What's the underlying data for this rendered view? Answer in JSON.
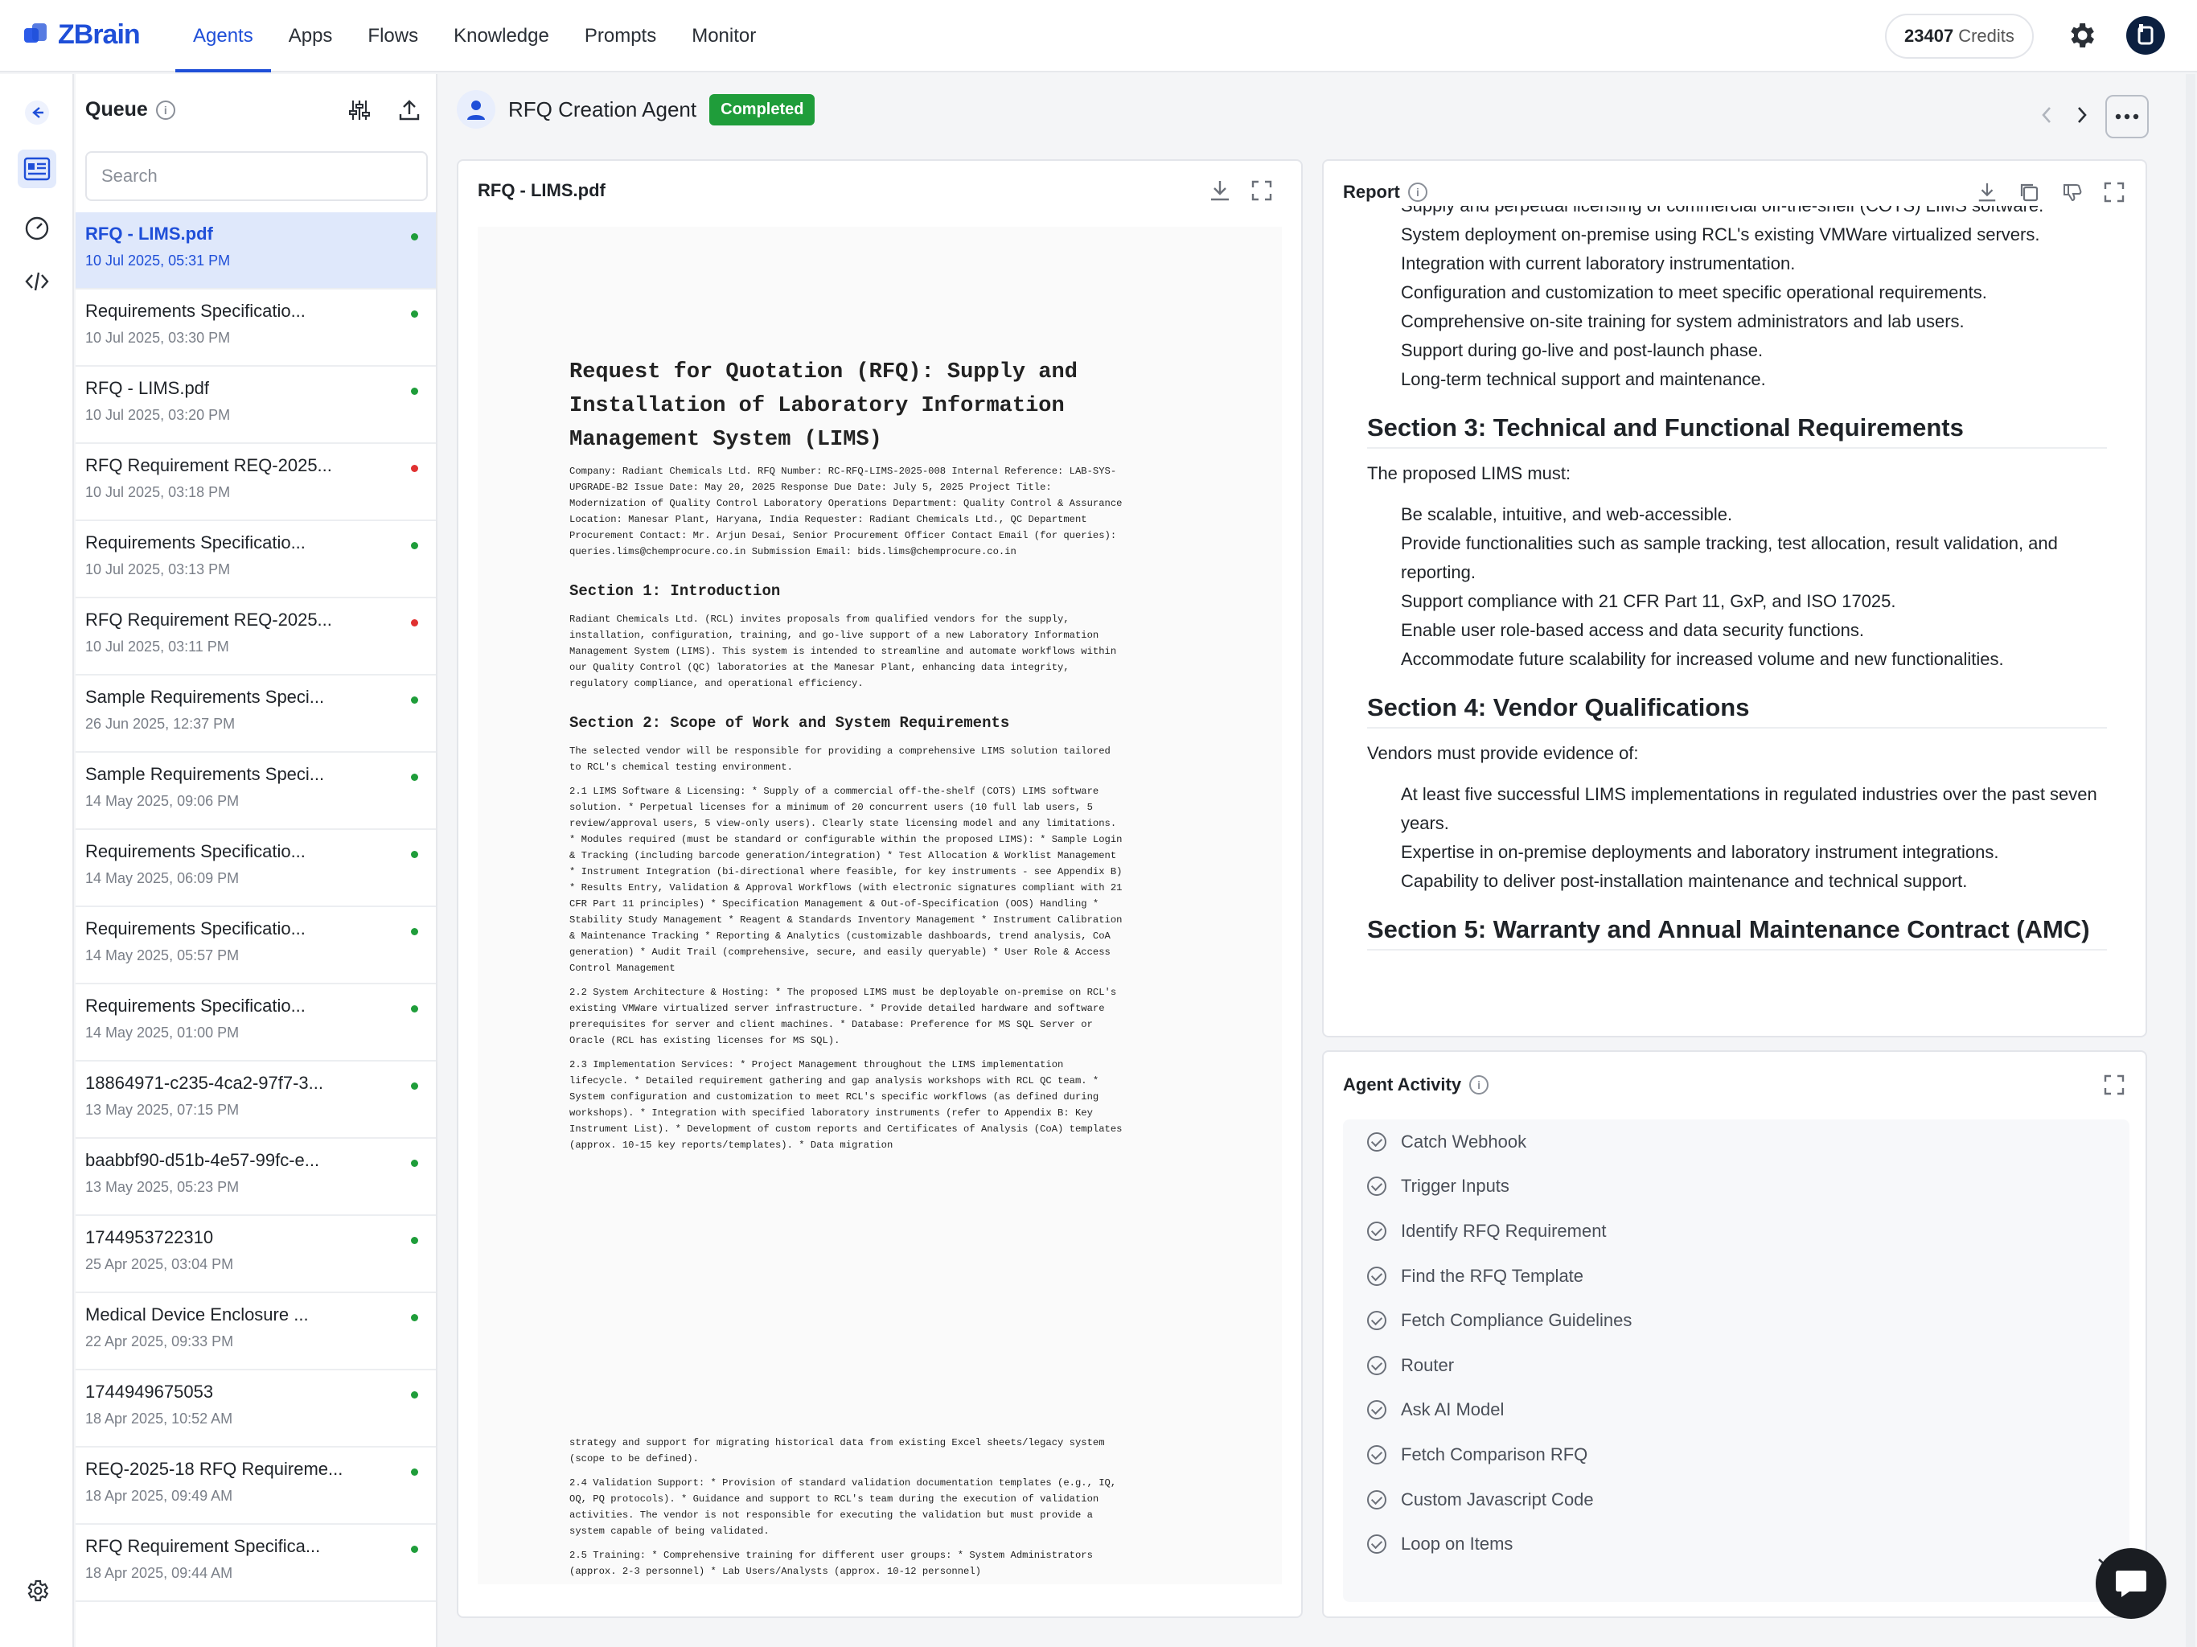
{
  "app": {
    "name": "ZBrain"
  },
  "nav": {
    "items": [
      "Agents",
      "Apps",
      "Flows",
      "Knowledge",
      "Prompts",
      "Monitor"
    ],
    "active": "Agents"
  },
  "credits": {
    "value": "23407",
    "label": "Credits"
  },
  "queue": {
    "title": "Queue",
    "search_placeholder": "Search",
    "items": [
      {
        "title": "RFQ - LIMS.pdf",
        "date": "10 Jul 2025, 05:31 PM",
        "status": "green"
      },
      {
        "title": "Requirements Specificatio...",
        "date": "10 Jul 2025, 03:30 PM",
        "status": "green"
      },
      {
        "title": "RFQ - LIMS.pdf",
        "date": "10 Jul 2025, 03:20 PM",
        "status": "green"
      },
      {
        "title": "RFQ Requirement REQ-2025...",
        "date": "10 Jul 2025, 03:18 PM",
        "status": "red"
      },
      {
        "title": "Requirements Specificatio...",
        "date": "10 Jul 2025, 03:13 PM",
        "status": "green"
      },
      {
        "title": "RFQ Requirement REQ-2025...",
        "date": "10 Jul 2025, 03:11 PM",
        "status": "red"
      },
      {
        "title": "Sample Requirements Speci...",
        "date": "26 Jun 2025, 12:37 PM",
        "status": "green"
      },
      {
        "title": "Sample Requirements Speci...",
        "date": "14 May 2025, 09:06 PM",
        "status": "green"
      },
      {
        "title": "Requirements Specificatio...",
        "date": "14 May 2025, 06:09 PM",
        "status": "green"
      },
      {
        "title": "Requirements Specificatio...",
        "date": "14 May 2025, 05:57 PM",
        "status": "green"
      },
      {
        "title": "Requirements Specificatio...",
        "date": "14 May 2025, 01:00 PM",
        "status": "green"
      },
      {
        "title": "18864971-c235-4ca2-97f7-3...",
        "date": "13 May 2025, 07:15 PM",
        "status": "green"
      },
      {
        "title": "baabbf90-d51b-4e57-99fc-e...",
        "date": "13 May 2025, 05:23 PM",
        "status": "green"
      },
      {
        "title": "1744953722310",
        "date": "25 Apr 2025, 03:04 PM",
        "status": "green"
      },
      {
        "title": "Medical Device Enclosure ...",
        "date": "22 Apr 2025, 09:33 PM",
        "status": "green"
      },
      {
        "title": "1744949675053",
        "date": "18 Apr 2025, 10:52 AM",
        "status": "green"
      },
      {
        "title": "REQ-2025-18 RFQ Requireme...",
        "date": "18 Apr 2025, 09:49 AM",
        "status": "green"
      },
      {
        "title": "RFQ Requirement Specifica...",
        "date": "18 Apr 2025, 09:44 AM",
        "status": "green"
      }
    ]
  },
  "agent": {
    "name": "RFQ Creation Agent",
    "status": "Completed"
  },
  "pdf": {
    "title": "RFQ - LIMS.pdf",
    "heading": "Request for Quotation (RFQ): Supply and Installation of Laboratory Information Management System (LIMS)",
    "meta": "Company: Radiant Chemicals Ltd. RFQ Number: RC-RFQ-LIMS-2025-008 Internal Reference: LAB-SYS-UPGRADE-B2 Issue Date: May 20, 2025 Response Due Date: July 5, 2025 Project Title: Modernization of Quality Control Laboratory Operations Department: Quality Control & Assurance Location: Manesar Plant, Haryana, India Requester: Radiant Chemicals Ltd., QC Department Procurement Contact: Mr. Arjun Desai, Senior Procurement Officer Contact Email (for queries): queries.lims@chemprocure.co.in Submission Email: bids.lims@chemprocure.co.in",
    "s1_title": "Section 1: Introduction",
    "s1_text": "Radiant Chemicals Ltd. (RCL) invites proposals from qualified vendors for the supply, installation, configuration, training, and go-live support of a new Laboratory Information Management System (LIMS). This system is intended to streamline and automate workflows within our Quality Control (QC) laboratories at the Manesar Plant, enhancing data integrity, regulatory compliance, and operational efficiency.",
    "s2_title": "Section 2: Scope of Work and System Requirements",
    "s2_intro": "The selected vendor will be responsible for providing a comprehensive LIMS solution tailored to RCL's chemical testing environment.",
    "s2_1": "2.1 LIMS Software & Licensing: * Supply of a commercial off-the-shelf (COTS) LIMS software solution. * Perpetual licenses for a minimum of 20 concurrent users (10 full lab users, 5 review/approval users, 5 view-only users). Clearly state licensing model and any limitations. * Modules required (must be standard or configurable within the proposed LIMS): * Sample Login & Tracking (including barcode generation/integration) * Test Allocation & Worklist Management * Instrument Integration (bi-directional where feasible, for key instruments - see Appendix B) * Results Entry, Validation & Approval Workflows (with electronic signatures compliant with 21 CFR Part 11 principles) * Specification Management & Out-of-Specification (OOS) Handling * Stability Study Management * Reagent & Standards Inventory Management * Instrument Calibration & Maintenance Tracking * Reporting & Analytics (customizable dashboards, trend analysis, CoA generation) * Audit Trail (comprehensive, secure, and easily queryable) * User Role & Access Control Management",
    "s2_2": "2.2 System Architecture & Hosting: * The proposed LIMS must be deployable on-premise on RCL's existing VMWare virtualized server infrastructure. * Provide detailed hardware and software prerequisites for server and client machines. * Database: Preference for MS SQL Server or Oracle (RCL has existing licenses for MS SQL).",
    "s2_3": "2.3 Implementation Services: * Project Management throughout the LIMS implementation lifecycle. * Detailed requirement gathering and gap analysis workshops with RCL QC team. * System configuration and customization to meet RCL's specific workflows (as defined during workshops). * Integration with specified laboratory instruments (refer to Appendix B: Key Instrument List). * Development of custom reports and Certificates of Analysis (CoA) templates (approx. 10-15 key reports/templates). * Data migration",
    "cont": "strategy and support for migrating historical data from existing Excel sheets/legacy system (scope to be defined).",
    "s2_4": "2.4 Validation Support: * Provision of standard validation documentation templates (e.g., IQ, OQ, PQ protocols). * Guidance and support to RCL's team during the execution of validation activities. The vendor is not responsible for executing the validation but must provide a system capable of being validated.",
    "s2_5": "2.5 Training: * Comprehensive training for different user groups: * System Administrators (approx. 2-3 personnel) * Lab Users/Analysts (approx. 10-12 personnel)"
  },
  "report": {
    "title": "Report",
    "top_items": [
      "Supply and perpetual licensing of commercial off-the-shelf (COTS) LIMS software.",
      "System deployment on-premise using RCL's existing VMWare virtualized servers.",
      "Integration with current laboratory instrumentation.",
      "Configuration and customization to meet specific operational requirements.",
      "Comprehensive on-site training for system administrators and lab users.",
      "Support during go-live and post-launch phase.",
      "Long-term technical support and maintenance."
    ],
    "s3_title": "Section 3: Technical and Functional Requirements",
    "s3_lead": "The proposed LIMS must:",
    "s3_items": [
      "Be scalable, intuitive, and web-accessible.",
      "Provide functionalities such as sample tracking, test allocation, result validation, and reporting.",
      "Support compliance with 21 CFR Part 11, GxP, and ISO 17025.",
      "Enable user role-based access and data security functions.",
      "Accommodate future scalability for increased volume and new functionalities."
    ],
    "s4_title": "Section 4: Vendor Qualifications",
    "s4_lead": "Vendors must provide evidence of:",
    "s4_items": [
      "At least five successful LIMS implementations in regulated industries over the past seven years.",
      "Expertise in on-premise deployments and laboratory instrument integrations.",
      "Capability to deliver post-installation maintenance and technical support."
    ],
    "s5_title": "Section 5: Warranty and Annual Maintenance Contract (AMC)"
  },
  "activity": {
    "title": "Agent Activity",
    "items": [
      "Catch Webhook",
      "Trigger Inputs",
      "Identify RFQ Requirement",
      "Find the RFQ Template",
      "Fetch Compliance Guidelines",
      "Router",
      "Ask AI Model",
      "Fetch Comparison RFQ",
      "Custom Javascript Code",
      "Loop on Items"
    ]
  },
  "colors": {
    "brand": "#1f4fd8",
    "success": "#1f9d3a",
    "status_green": "#1f9d3a",
    "status_red": "#e03131"
  }
}
